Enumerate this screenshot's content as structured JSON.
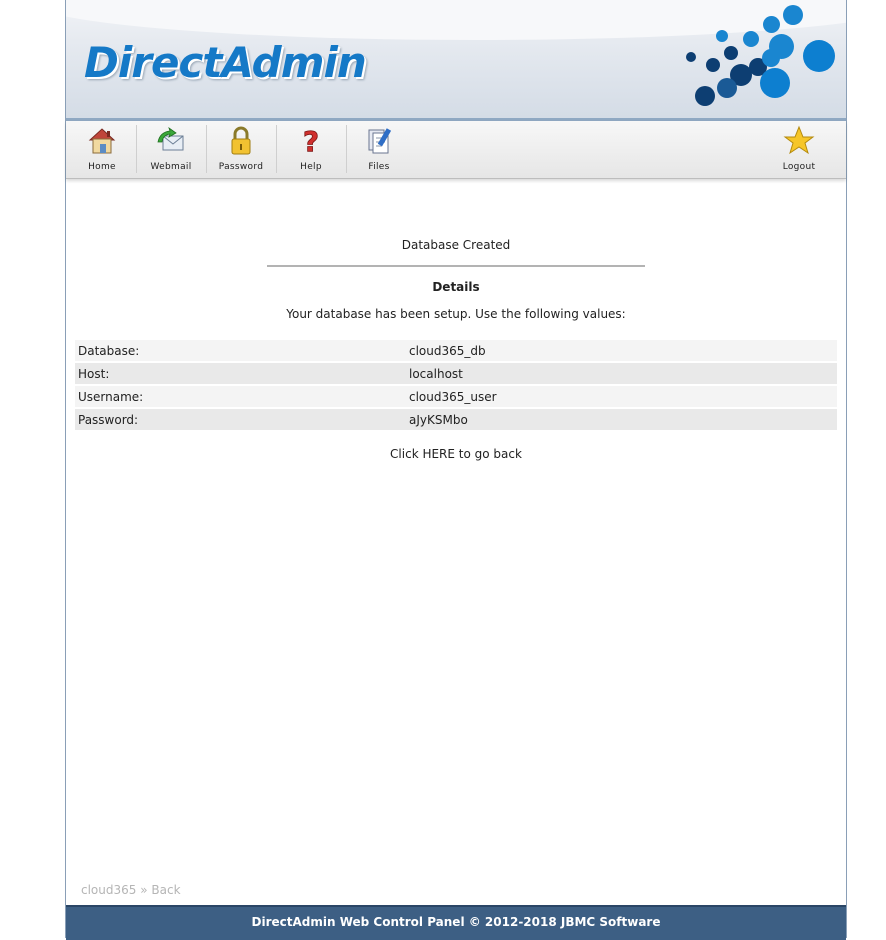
{
  "brand": {
    "logo_text": "DirectAdmin",
    "accent": "#1579c7"
  },
  "toolbar": {
    "home_label": "Home",
    "webmail_label": "Webmail",
    "password_label": "Password",
    "help_label": "Help",
    "files_label": "Files",
    "logout_label": "Logout"
  },
  "main": {
    "title": "Database Created",
    "details_heading": "Details",
    "setup_message": "Your database has been setup. Use the following values:",
    "rows": [
      {
        "label": "Database:",
        "value": "cloud365_db"
      },
      {
        "label": "Host:",
        "value": "localhost"
      },
      {
        "label": "Username:",
        "value": "cloud365_user"
      },
      {
        "label": "Password:",
        "value": "aJyKSMbo"
      }
    ],
    "back_link": "Click HERE to go back"
  },
  "breadcrumb": {
    "user": "cloud365",
    "separator": "»",
    "page": "Back"
  },
  "footer": {
    "text": "DirectAdmin Web Control Panel © 2012-2018 JBMC Software",
    "bg": "#3d5f84"
  }
}
